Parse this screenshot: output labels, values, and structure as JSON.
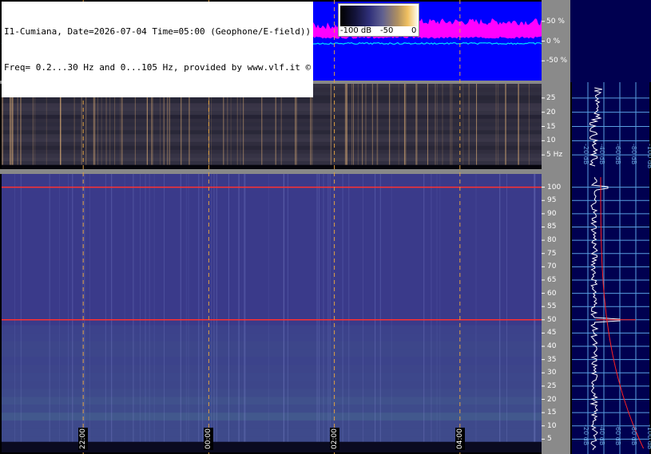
{
  "header": {
    "line1": "I1-Cumiana, Date=2026-07-04 Time=05:00 (Geophone/E-field))",
    "line2": "Freq= 0.2...30 Hz and 0...105 Hz, provided by www.vlf.it ©"
  },
  "colorbar": {
    "labels": [
      "-100 dB",
      "-50",
      "0"
    ],
    "colors": [
      "#000000",
      "#30307a",
      "#606090",
      "#f0c060",
      "#fff8e0"
    ]
  },
  "colors": {
    "waveform_bg": "#0000ff",
    "waveform_trace": "#ff00ff",
    "baseline_trace": "#00e0ff",
    "spectrogram_bg": "#3a3a8a",
    "side_bg": "#000050",
    "grid": "#5aa0e0",
    "hline": "#ff3030",
    "timeline": "#e0a040"
  },
  "chart_data": [
    {
      "type": "line",
      "panel": "waveform",
      "y_ticks": [
        "50 %",
        "0 %",
        "-50 %"
      ],
      "y_values": [
        50,
        0,
        -50
      ],
      "ylim": [
        -100,
        100
      ]
    },
    {
      "type": "heatmap",
      "panel": "spectrogram-low",
      "ylabel": "Hz",
      "y_ticks": [
        "25",
        "20",
        "15",
        "10",
        "5 Hz"
      ],
      "y_values": [
        25,
        20,
        15,
        10,
        5
      ],
      "ylim": [
        0,
        30
      ],
      "side_db_labels": [
        "-100 dB",
        "-80 dB",
        "-60 dB",
        "-40 dB",
        "-20 dB"
      ]
    },
    {
      "type": "heatmap",
      "panel": "spectrogram-high",
      "y_ticks": [
        "100",
        "95",
        "90",
        "85",
        "80",
        "75",
        "70",
        "65",
        "60",
        "55",
        "50",
        "45",
        "40",
        "35",
        "30",
        "25",
        "20",
        "15",
        "10",
        "5"
      ],
      "y_values": [
        100,
        95,
        90,
        85,
        80,
        75,
        70,
        65,
        60,
        55,
        50,
        45,
        40,
        35,
        30,
        25,
        20,
        15,
        10,
        5
      ],
      "ylim": [
        0,
        105
      ],
      "horizontal_lines_hz": [
        100,
        50
      ],
      "side_db_labels": [
        "-100 dB",
        "-80 dB",
        "-60 dB",
        "-40 dB",
        "-20 dB"
      ]
    }
  ],
  "time_axis": {
    "labels": [
      "22:00",
      "00:00",
      "02:00",
      "04:00"
    ],
    "values_hours": [
      22,
      24,
      26,
      28
    ],
    "range_hours": [
      20.7,
      29.3
    ]
  }
}
